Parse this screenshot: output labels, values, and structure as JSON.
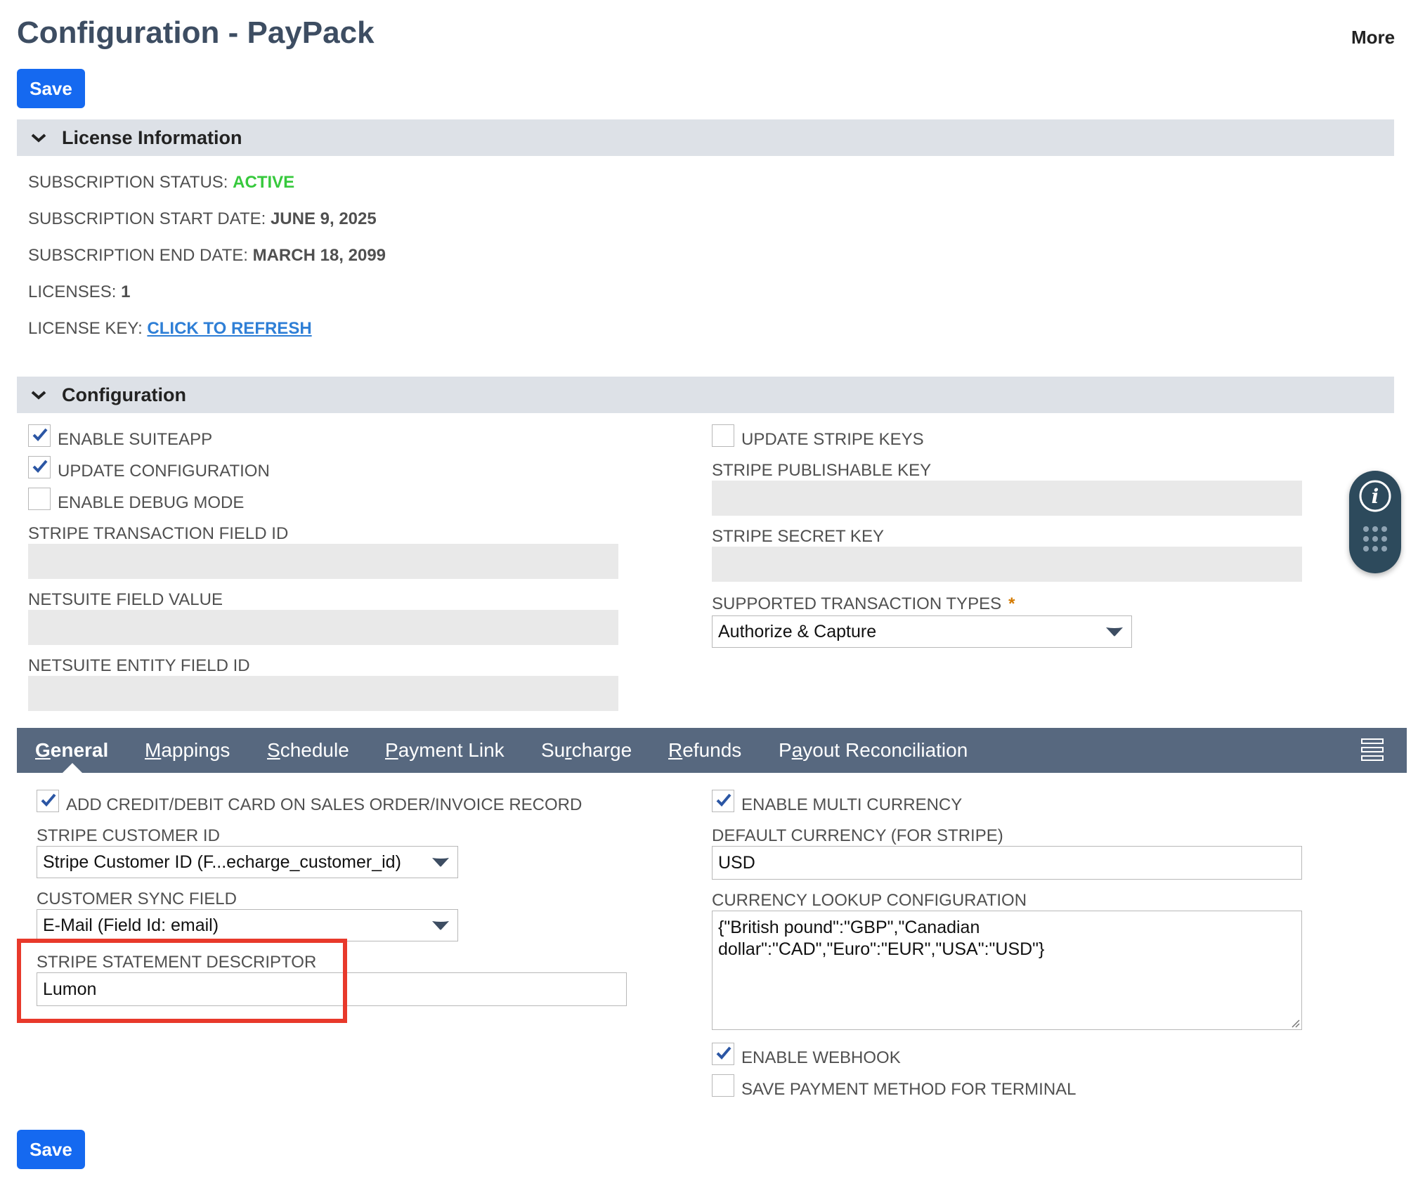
{
  "header": {
    "title": "Configuration - PayPack",
    "more_label": "More"
  },
  "toolbar": {
    "save_label": "Save"
  },
  "license": {
    "section_label": "License Information",
    "subscription_status_label": "SUBSCRIPTION STATUS:",
    "subscription_status_value": "ACTIVE",
    "start_date_label": "SUBSCRIPTION START DATE:",
    "start_date_value": "JUNE 9, 2025",
    "end_date_label": "SUBSCRIPTION END DATE:",
    "end_date_value": "MARCH 18, 2099",
    "licenses_label": "LICENSES:",
    "licenses_value": "1",
    "license_key_label": "LICENSE KEY:",
    "license_key_link": "CLICK TO REFRESH"
  },
  "configuration": {
    "section_label": "Configuration",
    "enable_suiteapp": {
      "label": "ENABLE SUITEAPP",
      "checked": true
    },
    "update_configuration": {
      "label": "UPDATE CONFIGURATION",
      "checked": true
    },
    "enable_debug_mode": {
      "label": "ENABLE DEBUG MODE",
      "checked": false
    },
    "stripe_transaction_field_id_label": "STRIPE TRANSACTION FIELD ID",
    "netsuite_field_value_label": "NETSUITE FIELD VALUE",
    "netsuite_entity_field_id_label": "NETSUITE ENTITY FIELD ID",
    "update_stripe_keys": {
      "label": "UPDATE STRIPE KEYS",
      "checked": false
    },
    "stripe_publishable_key_label": "STRIPE PUBLISHABLE KEY",
    "stripe_secret_key_label": "STRIPE SECRET KEY",
    "supported_transaction_types_label": "SUPPORTED TRANSACTION TYPES",
    "required_marker": "*",
    "supported_transaction_types_value": "Authorize & Capture"
  },
  "tabs": [
    {
      "underline": "G",
      "rest": "eneral",
      "active": true
    },
    {
      "underline": "M",
      "rest": "appings"
    },
    {
      "underline": "S",
      "rest": "chedule"
    },
    {
      "underline": "P",
      "rest": "ayment Link"
    },
    {
      "pre": "Su",
      "underline": "r",
      "rest": "charge"
    },
    {
      "underline": "R",
      "rest": "efunds"
    },
    {
      "pre": "P",
      "underline": "a",
      "rest": "yout Reconciliation"
    }
  ],
  "general": {
    "add_card": {
      "label": "ADD CREDIT/DEBIT CARD ON SALES ORDER/INVOICE RECORD",
      "checked": true
    },
    "stripe_customer_id_label": "STRIPE CUSTOMER ID",
    "stripe_customer_id_value": "Stripe Customer ID (F...echarge_customer_id)",
    "customer_sync_field_label": "CUSTOMER SYNC FIELD",
    "customer_sync_field_value": "E-Mail (Field Id: email)",
    "stripe_statement_descriptor_label": "STRIPE STATEMENT DESCRIPTOR",
    "stripe_statement_descriptor_value": "Lumon",
    "enable_multi_currency": {
      "label": "ENABLE MULTI CURRENCY",
      "checked": true
    },
    "default_currency_label": "DEFAULT CURRENCY (FOR STRIPE)",
    "default_currency_value": "USD",
    "currency_lookup_label": "CURRENCY LOOKUP CONFIGURATION",
    "currency_lookup_line1": "{\"British pound\":\"GBP\",\"Canadian",
    "currency_lookup_line2": "dollar\":\"CAD\",\"Euro\":\"EUR\",\"USA\":\"USD\"}",
    "enable_webhook": {
      "label": "ENABLE WEBHOOK",
      "checked": true
    },
    "save_payment_method_terminal": {
      "label": "SAVE PAYMENT METHOD FOR TERMINAL",
      "checked": false
    }
  },
  "colors": {
    "save_button": "#1569f0",
    "tab_bar": "#57687f",
    "section_header": "#dde1e7",
    "active_status": "#37c93d",
    "link": "#2f7fd6",
    "highlight": "#e8392b"
  }
}
